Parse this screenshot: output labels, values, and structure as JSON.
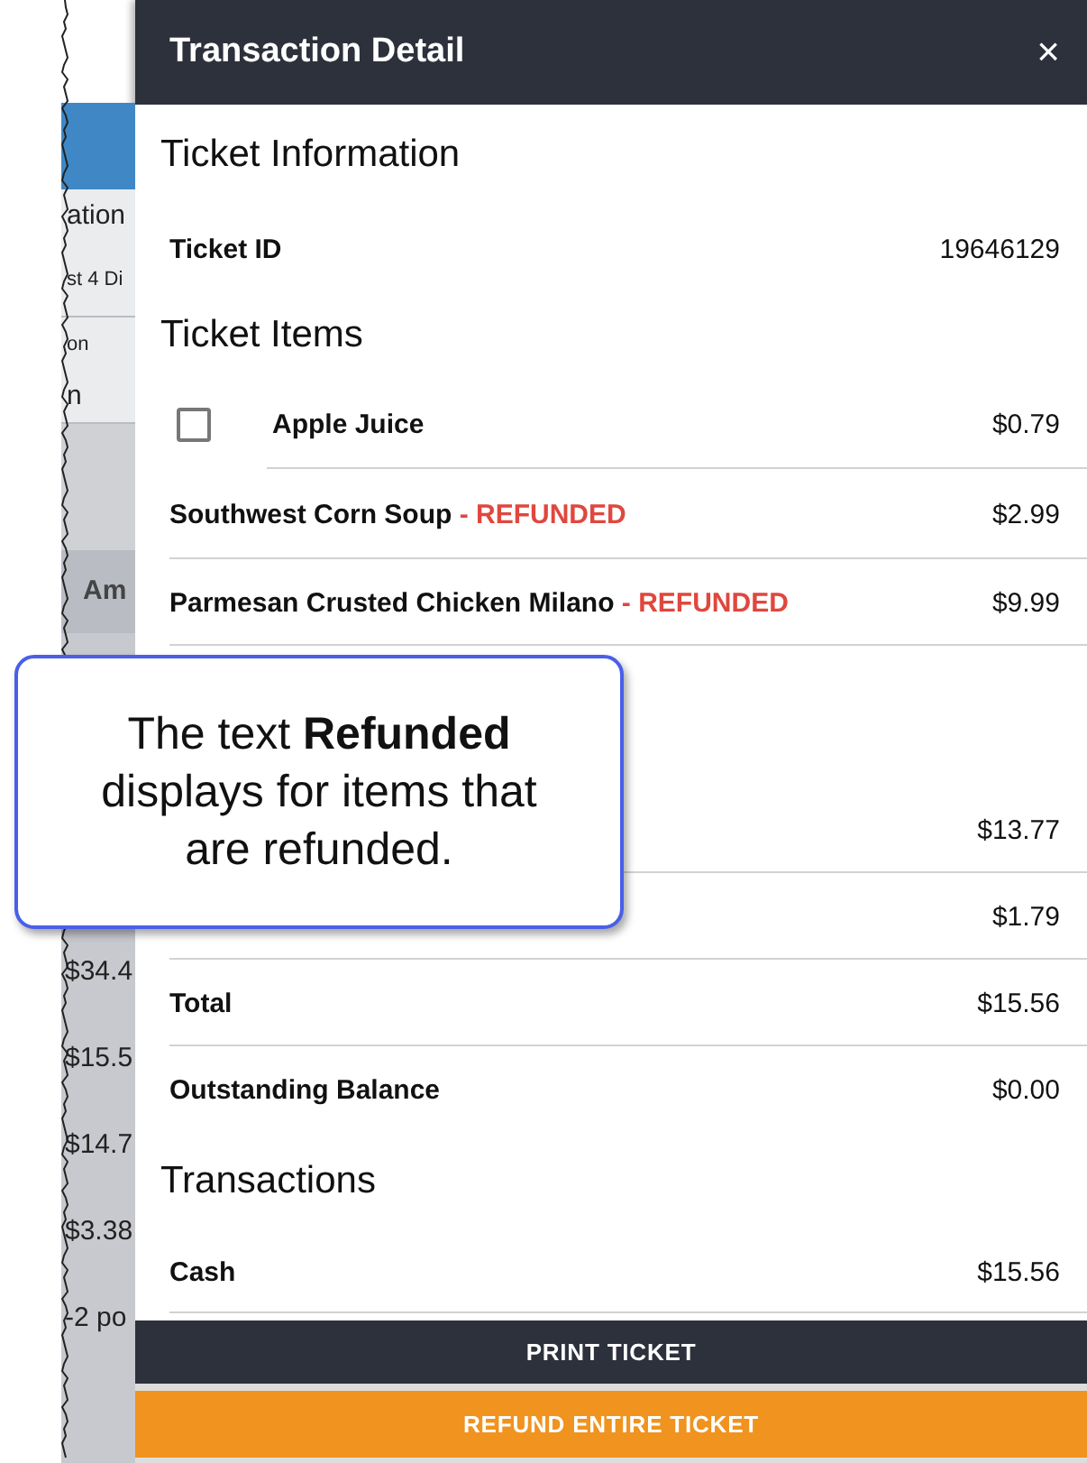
{
  "backdrop": {
    "heading_fragment": "ation",
    "subtext_fragment": "st 4 Di",
    "field_fragments": [
      "on",
      "n"
    ],
    "column_header_fragment": "Am",
    "row_fragments": [
      "$34.4",
      "$15.5",
      "$14.7",
      "$3.38",
      "-2 po"
    ]
  },
  "panel": {
    "title": "Transaction Detail",
    "close": "×",
    "sections": [
      {
        "heading": "Ticket Information",
        "rows": [
          {
            "kind": "field",
            "label": "Ticket ID",
            "value": "19646129"
          }
        ]
      },
      {
        "heading": "Ticket Items",
        "rows": [
          {
            "kind": "checkitem",
            "checked": false,
            "label": "Apple Juice",
            "value": "$0.79",
            "divider": true
          },
          {
            "kind": "field",
            "label": "Southwest Corn Soup",
            "status": "- REFUNDED",
            "value": "$2.99",
            "divider": true
          },
          {
            "kind": "field",
            "label": "Parmesan Crusted Chicken Milano",
            "status": "- REFUNDED",
            "value": "$9.99",
            "divider": true
          }
        ]
      },
      {
        "rows": [
          {
            "kind": "field",
            "value": "$13.77",
            "divider": true
          },
          {
            "kind": "field",
            "value": "$1.79",
            "divider": true
          },
          {
            "kind": "field",
            "label": "Total",
            "value": "$15.56",
            "divider": true
          },
          {
            "kind": "field",
            "label": "Outstanding Balance",
            "value": "$0.00"
          }
        ]
      },
      {
        "heading": "Transactions",
        "rows": [
          {
            "kind": "field",
            "label": "Cash",
            "value": "$15.56",
            "divider": true
          }
        ]
      }
    ],
    "buttons": [
      {
        "kind": "dark",
        "label": "PRINT TICKET"
      },
      {
        "kind": "accent",
        "label": "REFUND ENTIRE TICKET"
      }
    ]
  },
  "callout": {
    "text": "The text **Refunded** displays for items that are refunded."
  }
}
